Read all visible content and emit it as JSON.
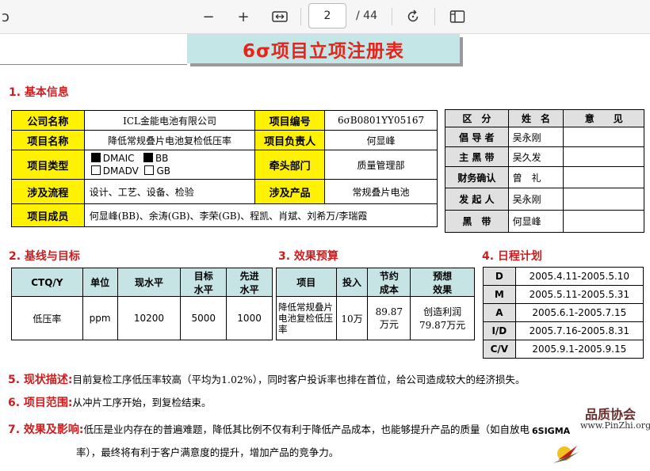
{
  "viewer": {
    "current_page": "2",
    "total_pages": "/ 44"
  },
  "document": {
    "title": "6σ项目立项注册表",
    "section1": "1. 基本信息",
    "section2": "2. 基线与目标",
    "section3": "3. 效果预算",
    "section4": "4. 日程计划",
    "basic": {
      "company_label": "公司名称",
      "company_value": "ICL金能电池有限公司",
      "project_no_label": "项目编号",
      "project_no_value": "6σB0801YY05167",
      "project_name_label": "项目名称",
      "project_name_value": "降低常规叠片电池复检低压率",
      "owner_label": "项目负责人",
      "owner_value": "何显峰",
      "type_label": "项目类型",
      "type_options": [
        "DMAIC",
        "BB",
        "DMADV",
        "GB"
      ],
      "dept_label": "牵头部门",
      "dept_value": "质量管理部",
      "process_label": "涉及流程",
      "process_value": "设计、工艺、设备、检验",
      "product_label": "涉及产品",
      "product_value": "常规叠片电池",
      "members_label": "项目成员",
      "members_value": "何显峰(BB)、余涛(GB)、李荣(GB)、程凯、肖斌、刘希万/李瑞霞"
    },
    "approval": {
      "headers": [
        "区　分",
        "姓　名",
        "意　　见"
      ],
      "rows": [
        {
          "role": "倡 导 者",
          "name": "吴永刚"
        },
        {
          "role": "主 黑 带",
          "name": "吴久发"
        },
        {
          "role": "财务确认",
          "name": "曾　礼"
        },
        {
          "role": "发 起 人",
          "name": "吴永刚"
        },
        {
          "role": "黑　带",
          "name": "何显峰"
        }
      ]
    },
    "baseline": {
      "headers": [
        "CTQ/Y",
        "单位",
        "现水平",
        "目标\n水平",
        "先进\n水平"
      ],
      "row": [
        "低压率",
        "ppm",
        "10200",
        "5000",
        "1000"
      ]
    },
    "budget": {
      "headers": [
        "项目",
        "投入",
        "节约\n成本",
        "预想\n效果"
      ],
      "row": [
        "降低常规叠片电池复检低压率",
        "10万",
        "89.87\n万元",
        "创造利润\n79.87万元"
      ]
    },
    "schedule": [
      {
        "code": "D",
        "range": "2005.4.11-2005.5.10"
      },
      {
        "code": "M",
        "range": "2005.5.11-2005.5.31"
      },
      {
        "code": "A",
        "range": "2005.6.1-2005.7.15"
      },
      {
        "code": "I/D",
        "range": "2005.7.16-2005.8.31"
      },
      {
        "code": "C/V",
        "range": "2005.9.1-2005.9.15"
      }
    ],
    "p5_label": "5. 现状描述:",
    "p5_text": "目前复检工序低压率较高（平均为1.02%），同时客户投诉率也排在首位，给公司造成较大的经济损失。",
    "p6_label": "6. 项目范围:",
    "p6_text": "从冲片工序开始，到复检结束。",
    "p7_label": "7. 效果及影响:",
    "p7_text1": "低压是业内存在的普遍难题，降低其比例不仅有利于降低产品成本，也能够提升产品的质量（如自放电",
    "p7_text2": "率），最终将有利于客户满意度的提升，增加产品的竞争力。",
    "logo_cn": "品质协会",
    "logo_url": "www.PinZhi.org",
    "logo_brand": "6SIGMA"
  }
}
